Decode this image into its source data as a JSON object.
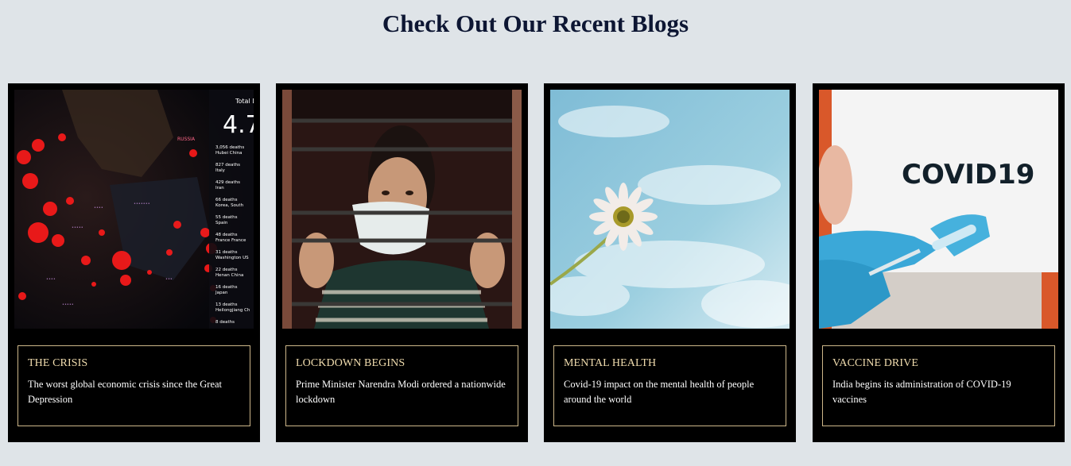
{
  "page": {
    "title": "Check Out Our Recent Blogs"
  },
  "blogs": [
    {
      "heading": "THE CRISIS",
      "description": "The worst global economic crisis since the Great Depression",
      "image": "covid-map-dashboard",
      "image_text": {
        "total": "Total De",
        "big_number": "4.7",
        "region_russia": "RUSSIA",
        "rows": [
          {
            "count": "3,056 deaths",
            "place": "Hubei China"
          },
          {
            "count": "827 deaths",
            "place": "Italy"
          },
          {
            "count": "429 deaths",
            "place": "Iran"
          },
          {
            "count": "66 deaths",
            "place": "Korea, South"
          },
          {
            "count": "55 deaths",
            "place": "Spain"
          },
          {
            "count": "48 deaths",
            "place": "France France"
          },
          {
            "count": "31 deaths",
            "place": "Washington US"
          },
          {
            "count": "22 deaths",
            "place": "Henan China"
          },
          {
            "count": "16 deaths",
            "place": "Japan"
          },
          {
            "count": "13 deaths",
            "place": "Heilongjiang Ch"
          },
          {
            "count": "8 deaths",
            "place": ""
          }
        ]
      }
    },
    {
      "heading": "LOCKDOWN BEGINS",
      "description": "Prime Minister Narendra Modi ordered a nationwide lockdown",
      "image": "woman-mask-behind-bars"
    },
    {
      "heading": "MENTAL HEALTH",
      "description": "Covid-19 impact on the mental health of people around the world",
      "image": "daisy-against-sky"
    },
    {
      "heading": "VACCINE DRIVE",
      "description": "India begins its administration of COVID-19 vaccines",
      "image": "covid19-vaccine-sign",
      "image_text": {
        "sign": "COVID19"
      }
    }
  ],
  "colors": {
    "page_background": "#dfe4e8",
    "title": "#0d1633",
    "card_background": "#000000",
    "card_border": "#cdb78a",
    "card_heading": "#f0dcae",
    "card_text": "#ffffff"
  }
}
